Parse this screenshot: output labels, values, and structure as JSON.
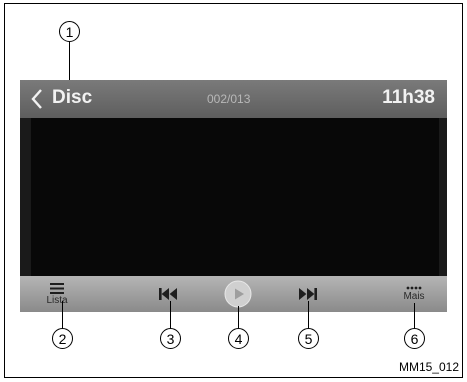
{
  "header": {
    "title": "Disc",
    "track_counter": "002/013",
    "clock": "11h38"
  },
  "controls": {
    "list_label": "Lista",
    "more_label": "Mais",
    "buttons": [
      "list-icon",
      "previous-track-icon",
      "play-icon",
      "next-track-icon",
      "more-icon"
    ]
  },
  "callouts": [
    "1",
    "2",
    "3",
    "4",
    "5",
    "6"
  ],
  "figure_ref": "MM15_012",
  "colors": {
    "header_bg": "#6b6b6b",
    "video_bg": "#080808",
    "controls_bg": "#9e9e9e",
    "play_button": "#d0d0d0"
  }
}
